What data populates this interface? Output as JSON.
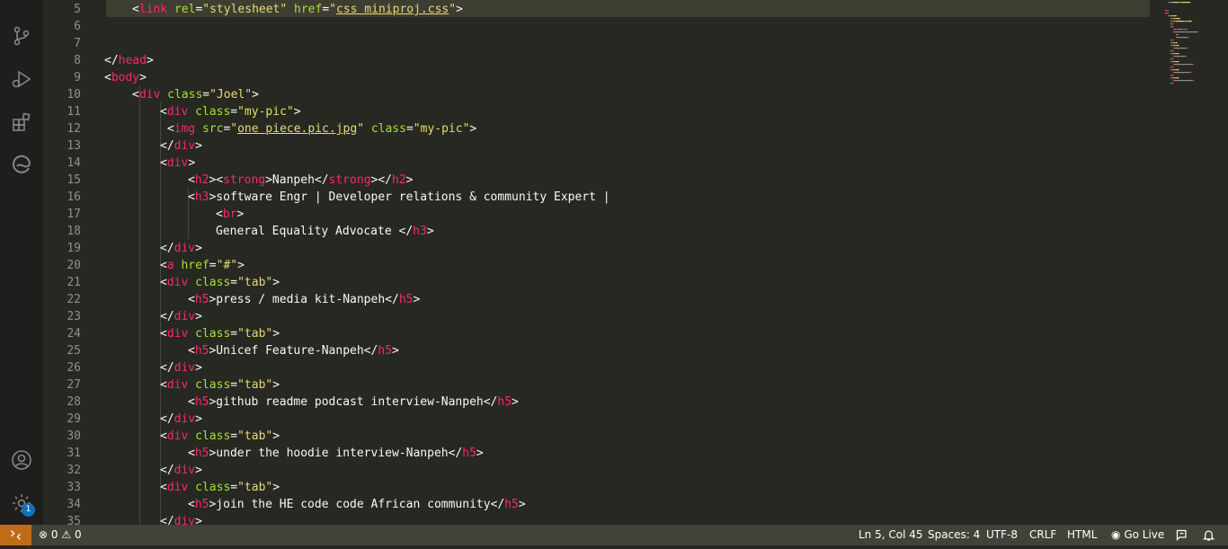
{
  "editor": {
    "lines": [
      {
        "n": "5",
        "indent": 1,
        "tokens": [
          [
            "p",
            "<"
          ],
          [
            "t",
            "link"
          ],
          [
            "p",
            " "
          ],
          [
            "a",
            "rel"
          ],
          [
            "p",
            "="
          ],
          [
            "s",
            "\"stylesheet\""
          ],
          [
            "p",
            " "
          ],
          [
            "a",
            "href"
          ],
          [
            "p",
            "="
          ],
          [
            "s",
            "\""
          ],
          [
            "su",
            "css miniproj.css"
          ],
          [
            "s",
            "\""
          ],
          [
            "p",
            ">"
          ]
        ]
      },
      {
        "n": "6",
        "indent": 0,
        "tokens": []
      },
      {
        "n": "7",
        "indent": 0,
        "tokens": []
      },
      {
        "n": "8",
        "indent": 0,
        "tokens": [
          [
            "p",
            "</"
          ],
          [
            "t",
            "head"
          ],
          [
            "p",
            ">"
          ]
        ]
      },
      {
        "n": "9",
        "indent": 0,
        "tokens": [
          [
            "p",
            "<"
          ],
          [
            "t",
            "body"
          ],
          [
            "p",
            ">"
          ]
        ]
      },
      {
        "n": "10",
        "indent": 1,
        "tokens": [
          [
            "p",
            "<"
          ],
          [
            "t",
            "div"
          ],
          [
            "p",
            " "
          ],
          [
            "a",
            "class"
          ],
          [
            "p",
            "="
          ],
          [
            "s",
            "\"Joel\""
          ],
          [
            "p",
            ">"
          ]
        ]
      },
      {
        "n": "11",
        "indent": 2,
        "tokens": [
          [
            "p",
            "<"
          ],
          [
            "t",
            "div"
          ],
          [
            "p",
            " "
          ],
          [
            "a",
            "class"
          ],
          [
            "p",
            "="
          ],
          [
            "s",
            "\"my-pic\""
          ],
          [
            "p",
            ">"
          ]
        ]
      },
      {
        "n": "12",
        "indent": 2,
        "tokens": [
          [
            "p",
            " <"
          ],
          [
            "t",
            "img"
          ],
          [
            "p",
            " "
          ],
          [
            "a",
            "src"
          ],
          [
            "p",
            "="
          ],
          [
            "s",
            "\""
          ],
          [
            "su",
            "one piece.pic.jpg"
          ],
          [
            "s",
            "\""
          ],
          [
            "p",
            " "
          ],
          [
            "a",
            "class"
          ],
          [
            "p",
            "="
          ],
          [
            "s",
            "\"my-pic\""
          ],
          [
            "p",
            ">"
          ]
        ]
      },
      {
        "n": "13",
        "indent": 2,
        "tokens": [
          [
            "p",
            "</"
          ],
          [
            "t",
            "div"
          ],
          [
            "p",
            ">"
          ]
        ]
      },
      {
        "n": "14",
        "indent": 2,
        "tokens": [
          [
            "p",
            "<"
          ],
          [
            "t",
            "div"
          ],
          [
            "p",
            ">"
          ]
        ]
      },
      {
        "n": "15",
        "indent": 3,
        "tokens": [
          [
            "p",
            "<"
          ],
          [
            "t",
            "h2"
          ],
          [
            "p",
            "><"
          ],
          [
            "t",
            "strong"
          ],
          [
            "p",
            ">Nanpeh</"
          ],
          [
            "t",
            "strong"
          ],
          [
            "p",
            "></"
          ],
          [
            "t",
            "h2"
          ],
          [
            "p",
            ">"
          ]
        ]
      },
      {
        "n": "16",
        "indent": 3,
        "tokens": [
          [
            "p",
            "<"
          ],
          [
            "t",
            "h3"
          ],
          [
            "p",
            ">software Engr | Developer relations & community Expert |"
          ]
        ]
      },
      {
        "n": "17",
        "indent": 4,
        "tokens": [
          [
            "p",
            "<"
          ],
          [
            "t",
            "br"
          ],
          [
            "p",
            ">"
          ]
        ]
      },
      {
        "n": "18",
        "indent": 4,
        "tokens": [
          [
            "p",
            "General Equality Advocate </"
          ],
          [
            "t",
            "h3"
          ],
          [
            "p",
            ">"
          ]
        ]
      },
      {
        "n": "19",
        "indent": 2,
        "tokens": [
          [
            "p",
            "</"
          ],
          [
            "t",
            "div"
          ],
          [
            "p",
            ">"
          ]
        ]
      },
      {
        "n": "20",
        "indent": 2,
        "tokens": [
          [
            "p",
            "<"
          ],
          [
            "t",
            "a"
          ],
          [
            "p",
            " "
          ],
          [
            "a",
            "href"
          ],
          [
            "p",
            "="
          ],
          [
            "s",
            "\"#\""
          ],
          [
            "p",
            ">"
          ]
        ]
      },
      {
        "n": "21",
        "indent": 2,
        "tokens": [
          [
            "p",
            "<"
          ],
          [
            "t",
            "div"
          ],
          [
            "p",
            " "
          ],
          [
            "a",
            "class"
          ],
          [
            "p",
            "="
          ],
          [
            "s",
            "\"tab\""
          ],
          [
            "p",
            ">"
          ]
        ]
      },
      {
        "n": "22",
        "indent": 3,
        "tokens": [
          [
            "p",
            "<"
          ],
          [
            "t",
            "h5"
          ],
          [
            "p",
            ">press / media kit-Nanpeh</"
          ],
          [
            "t",
            "h5"
          ],
          [
            "p",
            ">"
          ]
        ]
      },
      {
        "n": "23",
        "indent": 2,
        "tokens": [
          [
            "p",
            "</"
          ],
          [
            "t",
            "div"
          ],
          [
            "p",
            ">"
          ]
        ]
      },
      {
        "n": "24",
        "indent": 2,
        "tokens": [
          [
            "p",
            "<"
          ],
          [
            "t",
            "div"
          ],
          [
            "p",
            " "
          ],
          [
            "a",
            "class"
          ],
          [
            "p",
            "="
          ],
          [
            "s",
            "\"tab\""
          ],
          [
            "p",
            ">"
          ]
        ]
      },
      {
        "n": "25",
        "indent": 3,
        "tokens": [
          [
            "p",
            "<"
          ],
          [
            "t",
            "h5"
          ],
          [
            "p",
            ">Unicef Feature-Nanpeh</"
          ],
          [
            "t",
            "h5"
          ],
          [
            "p",
            ">"
          ]
        ]
      },
      {
        "n": "26",
        "indent": 2,
        "tokens": [
          [
            "p",
            "</"
          ],
          [
            "t",
            "div"
          ],
          [
            "p",
            ">"
          ]
        ]
      },
      {
        "n": "27",
        "indent": 2,
        "tokens": [
          [
            "p",
            "<"
          ],
          [
            "t",
            "div"
          ],
          [
            "p",
            " "
          ],
          [
            "a",
            "class"
          ],
          [
            "p",
            "="
          ],
          [
            "s",
            "\"tab\""
          ],
          [
            "p",
            ">"
          ]
        ]
      },
      {
        "n": "28",
        "indent": 3,
        "tokens": [
          [
            "p",
            "<"
          ],
          [
            "t",
            "h5"
          ],
          [
            "p",
            ">github readme podcast interview-Nanpeh</"
          ],
          [
            "t",
            "h5"
          ],
          [
            "p",
            ">"
          ]
        ]
      },
      {
        "n": "29",
        "indent": 2,
        "tokens": [
          [
            "p",
            "</"
          ],
          [
            "t",
            "div"
          ],
          [
            "p",
            ">"
          ]
        ]
      },
      {
        "n": "30",
        "indent": 2,
        "tokens": [
          [
            "p",
            "<"
          ],
          [
            "t",
            "div"
          ],
          [
            "p",
            " "
          ],
          [
            "a",
            "class"
          ],
          [
            "p",
            "="
          ],
          [
            "s",
            "\"tab\""
          ],
          [
            "p",
            ">"
          ]
        ]
      },
      {
        "n": "31",
        "indent": 3,
        "tokens": [
          [
            "p",
            "<"
          ],
          [
            "t",
            "h5"
          ],
          [
            "p",
            ">under the hoodie interview-Nanpeh</"
          ],
          [
            "t",
            "h5"
          ],
          [
            "p",
            ">"
          ]
        ]
      },
      {
        "n": "32",
        "indent": 2,
        "tokens": [
          [
            "p",
            "</"
          ],
          [
            "t",
            "div"
          ],
          [
            "p",
            ">"
          ]
        ]
      },
      {
        "n": "33",
        "indent": 2,
        "tokens": [
          [
            "p",
            "<"
          ],
          [
            "t",
            "div"
          ],
          [
            "p",
            " "
          ],
          [
            "a",
            "class"
          ],
          [
            "p",
            "="
          ],
          [
            "s",
            "\"tab\""
          ],
          [
            "p",
            ">"
          ]
        ]
      },
      {
        "n": "34",
        "indent": 3,
        "tokens": [
          [
            "p",
            "<"
          ],
          [
            "t",
            "h5"
          ],
          [
            "p",
            ">join the HE code code African community</"
          ],
          [
            "t",
            "h5"
          ],
          [
            "p",
            ">"
          ]
        ]
      },
      {
        "n": "35",
        "indent": 2,
        "tokens": [
          [
            "p",
            "</"
          ],
          [
            "t",
            "div"
          ],
          [
            "p",
            ">"
          ]
        ]
      }
    ]
  },
  "activity_bar": {
    "icons": [
      "source-control-icon",
      "run-debug-icon",
      "extensions-icon",
      "edge-browser-icon",
      "account-icon",
      "settings-gear-icon"
    ],
    "settings_badge": "1"
  },
  "status_bar": {
    "errors": "0",
    "warnings": "0",
    "position": "Ln 5, Col 45",
    "spaces": "Spaces: 4",
    "encoding": "UTF-8",
    "eol": "CRLF",
    "language": "HTML",
    "go_live": "Go Live"
  },
  "colors": {
    "editor_bg": "#272822",
    "tag": "#f92672",
    "attribute": "#a6e22e",
    "string": "#e6db74",
    "text": "#f8f8f2",
    "line_number": "#90908a",
    "status_bar": "#414339",
    "remote_indicator": "#c16a17",
    "badge": "#0e70c0"
  }
}
